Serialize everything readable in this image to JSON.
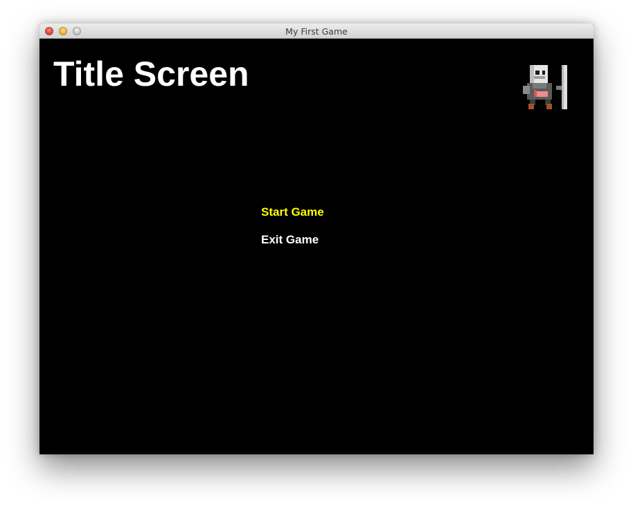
{
  "window": {
    "title": "My First Game"
  },
  "game": {
    "screen_title": "Title Screen",
    "menu": [
      {
        "label": "Start Game",
        "selected": true
      },
      {
        "label": "Exit Game",
        "selected": false
      }
    ],
    "colors": {
      "background": "#000000",
      "title": "#ffffff",
      "menu_selected": "#ffff00",
      "menu_default": "#ffffff"
    },
    "sprite": "knight-character-icon"
  }
}
